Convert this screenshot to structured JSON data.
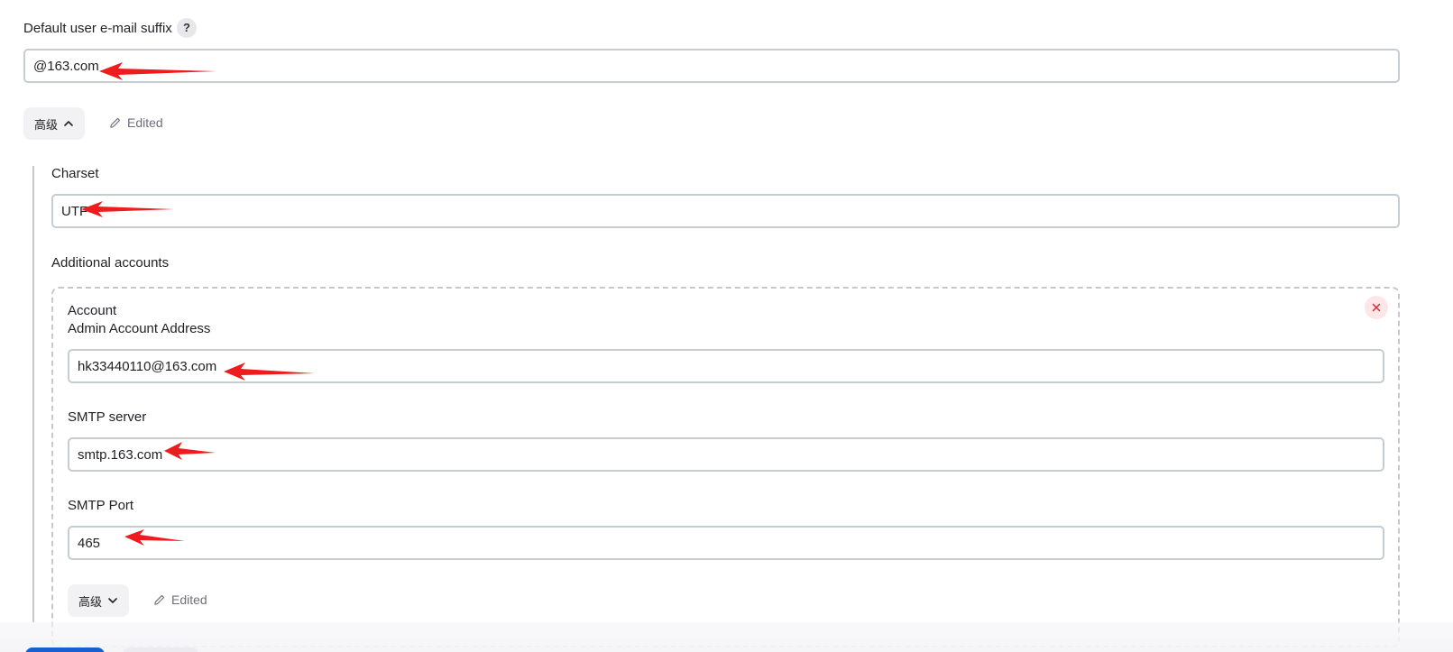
{
  "email_suffix": {
    "label": "Default user e-mail suffix",
    "help": "?",
    "value": "@163.com"
  },
  "advanced_outer": {
    "label": "高级",
    "edited": "Edited"
  },
  "charset": {
    "label": "Charset",
    "value": "UTF"
  },
  "additional_accounts": {
    "label": "Additional accounts",
    "account": {
      "title": "Account",
      "admin_label": "Admin Account Address",
      "admin_value": "hk33440110@163.com",
      "smtp_server_label": "SMTP server",
      "smtp_server_value": "smtp.163.com",
      "smtp_port_label": "SMTP Port",
      "smtp_port_value": "465",
      "advanced_label": "高级",
      "edited": "Edited"
    }
  },
  "colors": {
    "annotation_arrow": "#ee1c1c",
    "primary": "#1a5fd1",
    "remove": "#d6283a"
  },
  "icons": {
    "help": "question-icon",
    "chevron_up": "chevron-up-icon",
    "chevron_down": "chevron-down-icon",
    "edit": "pencil-icon",
    "remove": "close-icon",
    "annotation": "red-arrow-icon"
  }
}
